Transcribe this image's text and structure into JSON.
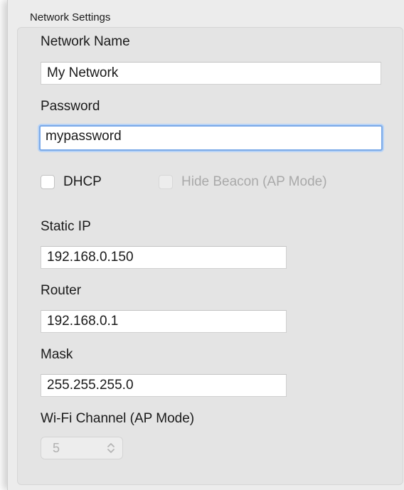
{
  "group": {
    "title": "Network Settings"
  },
  "network_name": {
    "label": "Network Name",
    "value": "My Network"
  },
  "password": {
    "label": "Password",
    "value": "mypassword"
  },
  "dhcp": {
    "label": "DHCP",
    "checked": false
  },
  "hide_beacon": {
    "label": "Hide Beacon (AP Mode)",
    "checked": false,
    "disabled": true
  },
  "static_ip": {
    "label": "Static IP",
    "value": "192.168.0.150"
  },
  "router": {
    "label": "Router",
    "value": "192.168.0.1"
  },
  "mask": {
    "label": "Mask",
    "value": "255.255.255.0"
  },
  "wifi_channel": {
    "label": "Wi-Fi Channel (AP Mode)",
    "value": "5",
    "disabled": true
  },
  "icons": {
    "stepper": "up-down-chevron-icon"
  },
  "colors": {
    "focus_ring": "#7aa9e8",
    "background": "#ececec"
  }
}
